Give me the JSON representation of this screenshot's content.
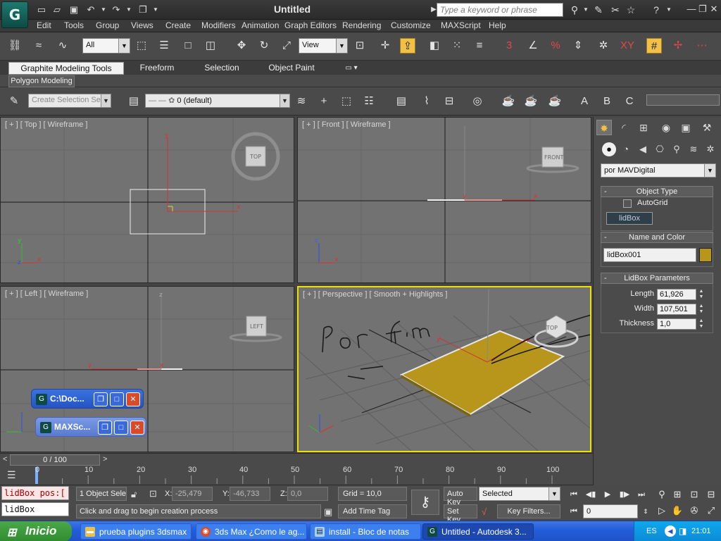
{
  "titlebar": {
    "title": "Untitled",
    "search_placeholder": "Type a keyword or phrase",
    "app_logo": "G"
  },
  "menu": [
    "Edit",
    "Tools",
    "Group",
    "Views",
    "Create",
    "Modifiers",
    "Animation",
    "Graph Editors",
    "Rendering",
    "Customize",
    "MAXScript",
    "Help"
  ],
  "main_toolbar": {
    "selection_filter": "All",
    "reference_coord": "View"
  },
  "ribbon": {
    "tabs": [
      "Graphite Modeling Tools",
      "Freeform",
      "Selection",
      "Object Paint"
    ],
    "active_tab": "Graphite Modeling Tools",
    "panel_tab": "Polygon Modeling"
  },
  "toolbar2": {
    "named_selection_placeholder": "Create Selection Se",
    "layer": "0 (default)"
  },
  "viewports": {
    "top": {
      "label": "[ + ] [ Top ] [ Wireframe ]",
      "cube": "TOP"
    },
    "front": {
      "label": "[ + ] [ Front ] [ Wireframe ]",
      "cube": "FRONT"
    },
    "left": {
      "label": "[ + ] [ Left ] [ Wireframe ]",
      "cube": "LEFT"
    },
    "perspective": {
      "label": "[ + ] [ Perspective ] [ Smooth + Highlights ]",
      "cube": "TOP"
    }
  },
  "floating_windows": [
    {
      "title": "C:\\Doc..."
    },
    {
      "title": "MAXSc..."
    }
  ],
  "command_panel": {
    "category": "por MAVDigital",
    "object_type": {
      "header": "Object Type",
      "autogrid_label": "AutoGrid",
      "button": "lidBox"
    },
    "name_color": {
      "header": "Name and Color",
      "name": "lidBox001",
      "color": "#b8961c"
    },
    "parameters": {
      "header": "LidBox Parameters",
      "length_label": "Length",
      "length": "61,926",
      "width_label": "Width",
      "width": "107,501",
      "thickness_label": "Thickness",
      "thickness": "1,0"
    }
  },
  "time_slider": {
    "position": "0 / 100",
    "ticks": [
      "0",
      "10",
      "20",
      "30",
      "40",
      "50",
      "60",
      "70",
      "80",
      "90",
      "100"
    ]
  },
  "status": {
    "maxscript_line1": "lidBox pos:[",
    "maxscript_line2": "lidBox",
    "selection": "1 Object Sele",
    "x_label": "X:",
    "x": "-25,479",
    "y_label": "Y:",
    "y": "-46,733",
    "z_label": "Z:",
    "z": "0,0",
    "grid": "Grid = 10,0",
    "prompt": "Click and drag to begin creation process",
    "add_time_tag": "Add Time Tag",
    "auto_key": "Auto Key",
    "set_key": "Set Key",
    "key_filter_selected": "Selected",
    "key_filters": "Key Filters...",
    "frame": "0"
  },
  "taskbar": {
    "start": "Inicio",
    "tasks": [
      {
        "label": "prueba plugins 3dsmax"
      },
      {
        "label": "3ds Max ¿Como le ag..."
      },
      {
        "label": "install - Bloc de notas"
      },
      {
        "label": "Untitled - Autodesk 3..."
      }
    ],
    "language": "ES",
    "clock": "21:01"
  }
}
